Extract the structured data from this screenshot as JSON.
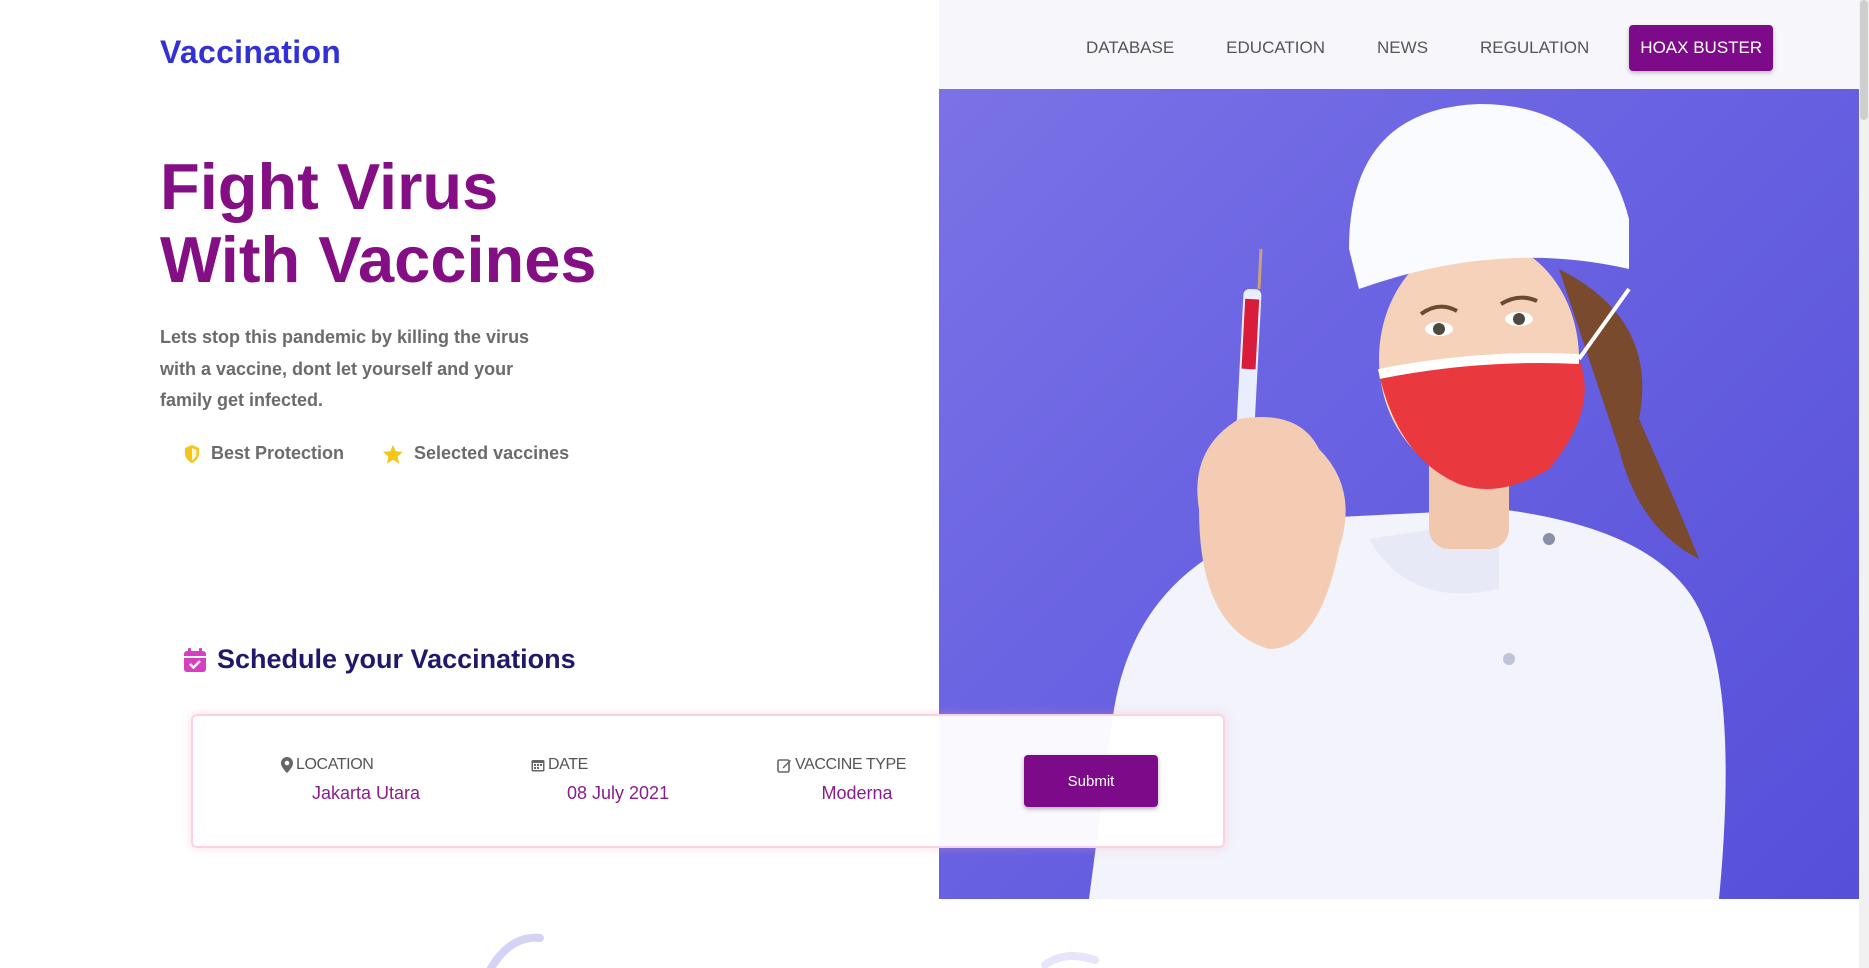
{
  "brand": {
    "name": "Vaccination"
  },
  "nav": {
    "items": [
      "DATABASE",
      "EDUCATION",
      "NEWS",
      "REGULATION"
    ],
    "cta_label": "HOAX BUSTER"
  },
  "hero": {
    "headline_line1": "Fight Virus",
    "headline_line2": "With Vaccines",
    "description": "Lets stop this pandemic by killing the virus with a vaccine, dont let yourself and your family get infected.",
    "features": [
      {
        "icon": "shield-icon",
        "label": "Best Protection"
      },
      {
        "icon": "star-icon",
        "label": "Selected vaccines"
      }
    ]
  },
  "schedule": {
    "title": "Schedule your Vaccinations",
    "fields": [
      {
        "icon": "map-pin-icon",
        "label": "LOCATION",
        "value": "Jakarta Utara"
      },
      {
        "icon": "calendar-icon",
        "label": "DATE",
        "value": "08 July 2021"
      },
      {
        "icon": "edit-icon",
        "label": "VACCINE TYPE",
        "value": "Moderna"
      }
    ],
    "submit_label": "Submit"
  },
  "colors": {
    "brand_blue": "#3131d6",
    "accent_purple": "#7d0b89",
    "headline_purple": "#840e83",
    "hero_bg": "#6a63e2",
    "feature_icon_yellow": "#f5c518"
  }
}
